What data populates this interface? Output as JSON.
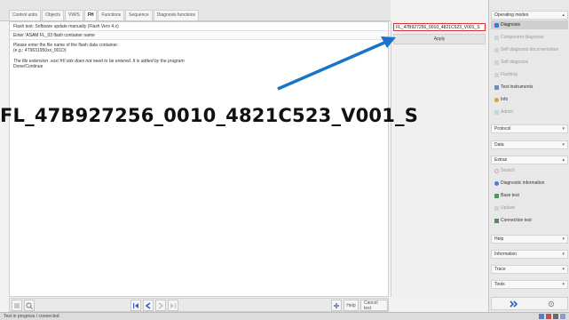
{
  "tabs": [
    {
      "label": "Control units"
    },
    {
      "label": "Objects"
    },
    {
      "label": "VW/S"
    },
    {
      "label": "FH"
    },
    {
      "label": "Functions"
    },
    {
      "label": "Sequence"
    },
    {
      "label": "Diagnosis functions"
    }
  ],
  "main": {
    "header_line1": "Flash test: Software update manually (Flash Vers 4.x)",
    "header_line2": "Enter 'ASAM FL_03 flash container name",
    "instruction_line1": "Please enter the file name of the flash data container.",
    "instruction_line2": "(e.g.: 4T9631950xx_001D)",
    "note_line": "The file extension .sox/.frf/.odx does not need to be entered. It is added by the program",
    "done_line": "Done/Continue"
  },
  "input": {
    "filename_value": "FL_47B927256_0010_4821C523_V001_S"
  },
  "apply_label": "Apply",
  "bottom_bar": {
    "help_label": "Help",
    "cancel_label": "Cancel test"
  },
  "overlay": {
    "big_label": "FL_47B927256_0010_4821C523_V001_S"
  },
  "status": {
    "text": "Test in progress / connected"
  },
  "sidebar": {
    "operating_modes": "Operating modes",
    "items": [
      {
        "label": "Diagnosis"
      },
      {
        "label": "Component diagnosis"
      },
      {
        "label": "Self diagnosis documentation"
      },
      {
        "label": "Self diagnosis"
      },
      {
        "label": "Flashing"
      },
      {
        "label": "Test instruments"
      },
      {
        "label": "Info"
      },
      {
        "label": "Admin"
      }
    ],
    "protocol": "Protocol",
    "data": "Data",
    "extras": "Extras",
    "extras_items": [
      {
        "label": "Search"
      },
      {
        "label": "Diagnostic information"
      },
      {
        "label": "Base test"
      },
      {
        "label": "Update"
      },
      {
        "label": "Connection test"
      }
    ],
    "help": "Help",
    "information": "Information",
    "trace": "Trace",
    "tools": "Tools"
  },
  "colors": {
    "accent": "#1a73c8",
    "arrow": "#1a73c8",
    "input_border": "#dd3333"
  }
}
